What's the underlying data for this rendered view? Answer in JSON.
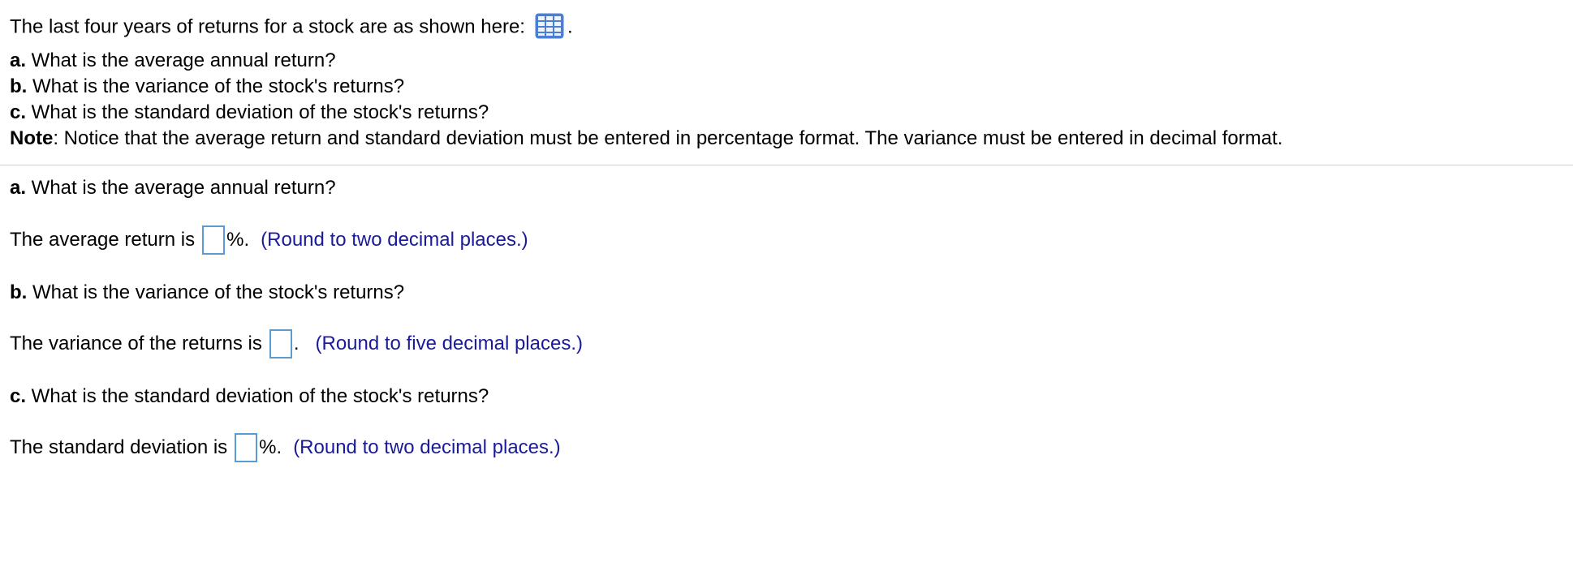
{
  "intro": {
    "text": "The last four years of returns for a stock are as shown here:",
    "icon": "data-table-icon",
    "trailing": "."
  },
  "questions": {
    "a": {
      "letter": "a.",
      "text": " What is the average annual return?"
    },
    "b": {
      "letter": "b.",
      "text": " What is the variance of the stock's returns?"
    },
    "c": {
      "letter": "c.",
      "text": " What is the standard deviation of the stock's returns?"
    }
  },
  "note": {
    "label": "Note",
    "text": ": Notice that the average return and standard deviation must be entered in percentage format. The variance must be entered in decimal format."
  },
  "parts": {
    "a": {
      "letter": "a.",
      "heading": " What is the average annual return?",
      "prefix": "The average return is",
      "value": "",
      "suffix": "%.",
      "hint": "(Round to two decimal places.)"
    },
    "b": {
      "letter": "b.",
      "heading": " What is the variance of the stock's returns?",
      "prefix": "The variance of the returns is",
      "value": "",
      "suffix": ".",
      "hint": "(Round to five decimal places.)"
    },
    "c": {
      "letter": "c.",
      "heading": " What is the standard deviation of the stock's returns?",
      "prefix": "The standard deviation is",
      "value": "",
      "suffix": "%.",
      "hint": "(Round to two decimal places.)"
    }
  },
  "colors": {
    "hint": "#1a1a9c",
    "input_border": "#5a9bd5",
    "icon": "#4a7fd4",
    "divider": "#cfcfcf"
  }
}
